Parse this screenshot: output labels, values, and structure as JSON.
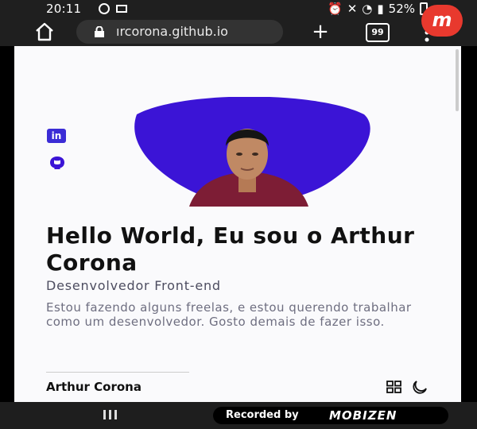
{
  "status_bar": {
    "time": "20:11",
    "battery": "52%"
  },
  "browser": {
    "url": "ırcorona.github.io",
    "tab_count": "99",
    "new_tab": "+"
  },
  "page": {
    "social": {
      "linkedin_label": "in"
    },
    "hero": {
      "title": "Hello World, Eu sou o Arthur Corona",
      "subtitle": "Desenvolvedor Front-end",
      "description": "Estou fazendo alguns freelas, e estou querendo trabalhar como um desenvolvedor. Gosto demais de fazer isso."
    },
    "footer": {
      "name": "Arthur Corona"
    }
  },
  "recorder": {
    "label": "Recorded by",
    "brand": "MOBIZEN"
  },
  "mobizen_badge": "m",
  "colors": {
    "accent": "#3b14d6",
    "shirt": "#7d1d35"
  },
  "icons": [
    "home-icon",
    "lock-icon",
    "plus-icon",
    "tabs-icon",
    "more-icon",
    "linkedin-icon",
    "github-icon",
    "grid-icon",
    "moon-icon"
  ]
}
